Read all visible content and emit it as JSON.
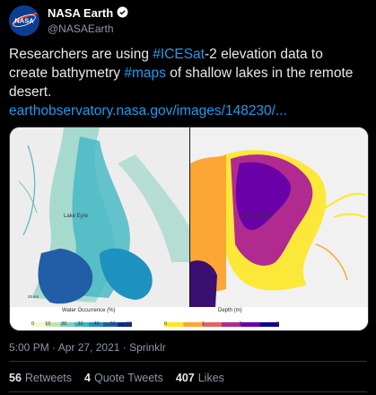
{
  "account": {
    "display_name": "NASA Earth",
    "handle": "@NASAEarth",
    "avatar_text": "NASA"
  },
  "tweet": {
    "text_1": "Researchers are using ",
    "hashtag_1": "#ICESat",
    "text_2": "-2 elevation data to create bathymetry ",
    "hashtag_2": "#maps",
    "text_3": " of shallow lakes in the remote desert.",
    "link": "earthobservatory.nasa.gov/images/148230/..."
  },
  "media": {
    "left_lake_label": "Lake Eyre",
    "right_lake_label": "Lago Coipasa",
    "scale_label": "25 km",
    "left_legend_title": "Water Occurrence (%)",
    "left_legend_ticks": [
      "0",
      "10",
      "20",
      "30",
      "40",
      "50",
      "60"
    ],
    "right_legend_title": "Depth (m)",
    "right_legend_ticks": [
      "0",
      "1",
      "2",
      "3"
    ],
    "left_ramp_colors": [
      "#f4f6d0",
      "#c2e3b0",
      "#7fcdbb",
      "#41b6c4",
      "#1d91c0",
      "#225ea8",
      "#0c2c84"
    ],
    "right_ramp_colors": [
      "#fde725",
      "#fca636",
      "#e16462",
      "#b12a90",
      "#6a00a8",
      "#0d0887"
    ]
  },
  "meta": {
    "timestamp": "5:00 PM · Apr 27, 2021 · Sprinklr"
  },
  "stats": {
    "retweets_count": "56",
    "retweets_label": "Retweets",
    "quotes_count": "4",
    "quotes_label": "Quote Tweets",
    "likes_count": "407",
    "likes_label": "Likes"
  }
}
